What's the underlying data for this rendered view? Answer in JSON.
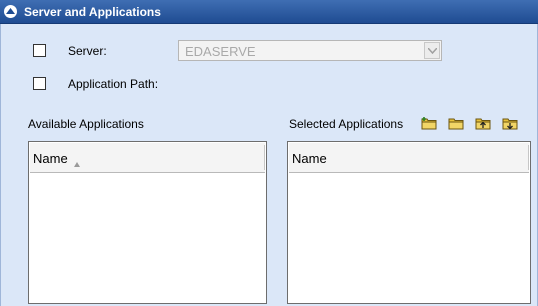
{
  "header": {
    "title": "Server and Applications"
  },
  "form": {
    "server_label": "Server:",
    "server_value": "EDASERVE",
    "app_path_label": "Application Path:"
  },
  "available": {
    "label": "Available Applications",
    "column": "Name"
  },
  "selected": {
    "label": "Selected Applications",
    "column": "Name"
  },
  "icons": {
    "collapse": "collapse-up-icon",
    "sort": "sort-ascending-icon",
    "toolbar": [
      "folder-add-icon",
      "folder-icon",
      "folder-move-up-icon",
      "folder-move-down-icon"
    ]
  }
}
